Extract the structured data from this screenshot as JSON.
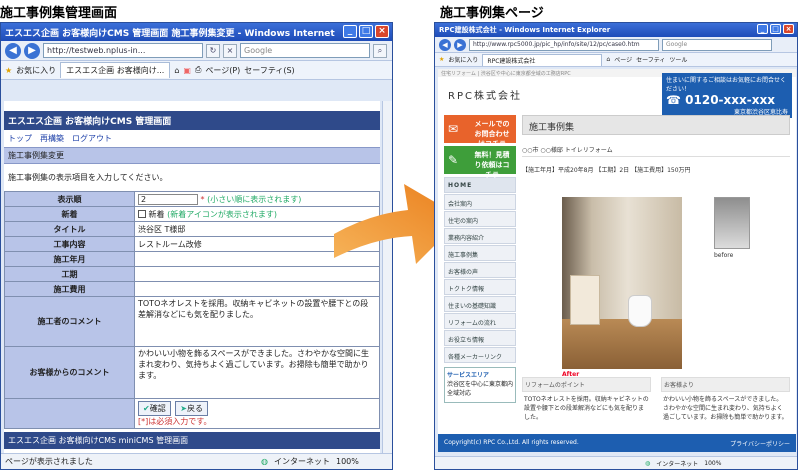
{
  "captions": {
    "left": "施工事例集管理画面",
    "right": "施工事例集ページ"
  },
  "left_window": {
    "title": "エスエス企画 お客様向けCMS 管理画面 施工事例集変更 - Windows Internet Explorer",
    "url": "http://testweb.nplus-in...",
    "search_placeholder": "Google",
    "favorites": "お気に入り",
    "tab": "エスエス企画 お客様向け...",
    "page_menu": "ページ(P)",
    "safety_menu": "セーフティ(S)",
    "status_text": "ページが表示されました",
    "zone": "インターネット",
    "zoom": "100%",
    "cms": {
      "header": "エスエス企画 お客様向けCMS 管理画面",
      "links": [
        "トップ",
        "再構築",
        "ログアウト"
      ],
      "breadcrumb": "施工事例集変更",
      "instruction": "施工事例集の表示項目を入力してください。",
      "rows": [
        {
          "label": "表示順",
          "value": "2",
          "note": "(小さい順に表示されます)"
        },
        {
          "label": "新着",
          "value": "新着",
          "note": "(新着アイコンが表示されます)"
        },
        {
          "label": "タイトル",
          "value": "渋谷区 T様邸"
        },
        {
          "label": "工事内容",
          "value": "レストルーム改修"
        },
        {
          "label": "施工年月",
          "value": ""
        },
        {
          "label": "工期",
          "value": ""
        },
        {
          "label": "施工費用",
          "value": ""
        },
        {
          "label": "施工者のコメント",
          "value": "TOTOネオレストを採用。収納キャビネットの設置や腰下との段差解消などにも気を配りました。"
        },
        {
          "label": "お客様からのコメント",
          "value": "かわいい小物を飾るスペースができました。さわやかな空間に生まれ変わり、気持ちよく過ごしています。お掃除も簡単で助かります。"
        }
      ],
      "confirm_button": "確認",
      "back_button": "戻る",
      "required_note": "[*]は必須入力です。",
      "footer": "エスエス企画 お客様向けCMS miniCMS 管理画面"
    }
  },
  "right_window": {
    "title": "RPC建設株式会社 - Windows Internet Explorer",
    "url": "http://www.rpc5000.jp/pic_hp/info/site/12/pc/case0.htm",
    "search_placeholder": "Google",
    "favorites": "お気に入り",
    "tab": "RPC建設株式会社",
    "page_menu": "ページ",
    "safety_menu": "セーフティ",
    "tools_menu": "ツール",
    "zone": "インターネット",
    "zoom": "100%",
    "site": {
      "top_text": "住宅リフォーム | 渋谷区や中心に東京都全域の工務店RPC",
      "logo": "RPC株式会社",
      "tel_lead": "住まいに関するご相談はお気軽にお問合せください！",
      "tel": "0120-xxx-xxx",
      "tel_sub": "東京都渋谷区恵比寿",
      "banners": [
        "メールでのお問合わせはコチラ",
        "無料！見積り依頼はコチラ"
      ],
      "menu": [
        "HOME",
        "会社案内",
        "住宅の案内",
        "業務内容紹介",
        "施工事例集",
        "お客様の声",
        "トクトク情報",
        "住まいの基礎知識",
        "リフォームの流れ",
        "お役立ち情報",
        "各種メーカーリンク"
      ],
      "service_area_title": "サービスエリア",
      "service_area_text": "渋谷区を中心に東京都内全域対応",
      "page_title": "施工事例集",
      "case_subtitle": "○○市 ○○様邸 トイレリフォーム",
      "case_info": "【施工年月】平成20年8月 【工期】2日 【施工費用】150万円",
      "after_label": "After",
      "before_label": "before",
      "comment_contractor_title": "リフォームのポイント",
      "comment_contractor_text": "TOTOネオレストを採用。収納キャビネットの設置や腰下との段差解消などにも気を配りました。",
      "comment_customer_title": "お客様より",
      "comment_customer_text": "かわいい小物を飾るスペースができました。さわやかな空間に生まれ変わり、気持ちよく過ごしています。お掃除も簡単で助かります。",
      "copyright": "Copyright(c) RPC Co.,Ltd. All rights reserved.",
      "privacy": "プライバシーポリシー"
    }
  },
  "colors": {
    "arrow": "#f0962f",
    "cms_header": "#2f4a8a",
    "site_blue": "#1d5eb0"
  }
}
